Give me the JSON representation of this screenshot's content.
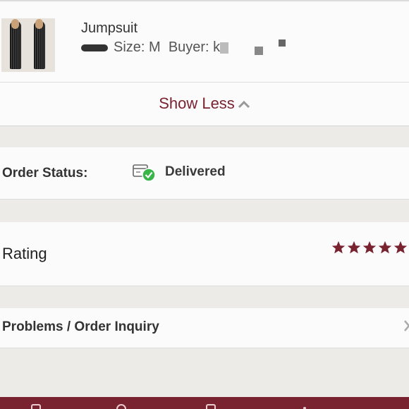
{
  "item": {
    "title": "Jumpsuit",
    "size_text": "Size: M",
    "buyer_text": "Buyer: k"
  },
  "show_less": {
    "label": "Show Less"
  },
  "order_status": {
    "label": "Order Status:",
    "value": "Delivered"
  },
  "rating": {
    "label": "Rating",
    "stars": 5,
    "star_color": "#7a2330"
  },
  "problems": {
    "label": "Problems / Order Inquiry"
  },
  "colors": {
    "accent": "#7a2330",
    "background": "#ecebe7",
    "panel": "#fbfbfb",
    "success": "#3ab54a"
  }
}
